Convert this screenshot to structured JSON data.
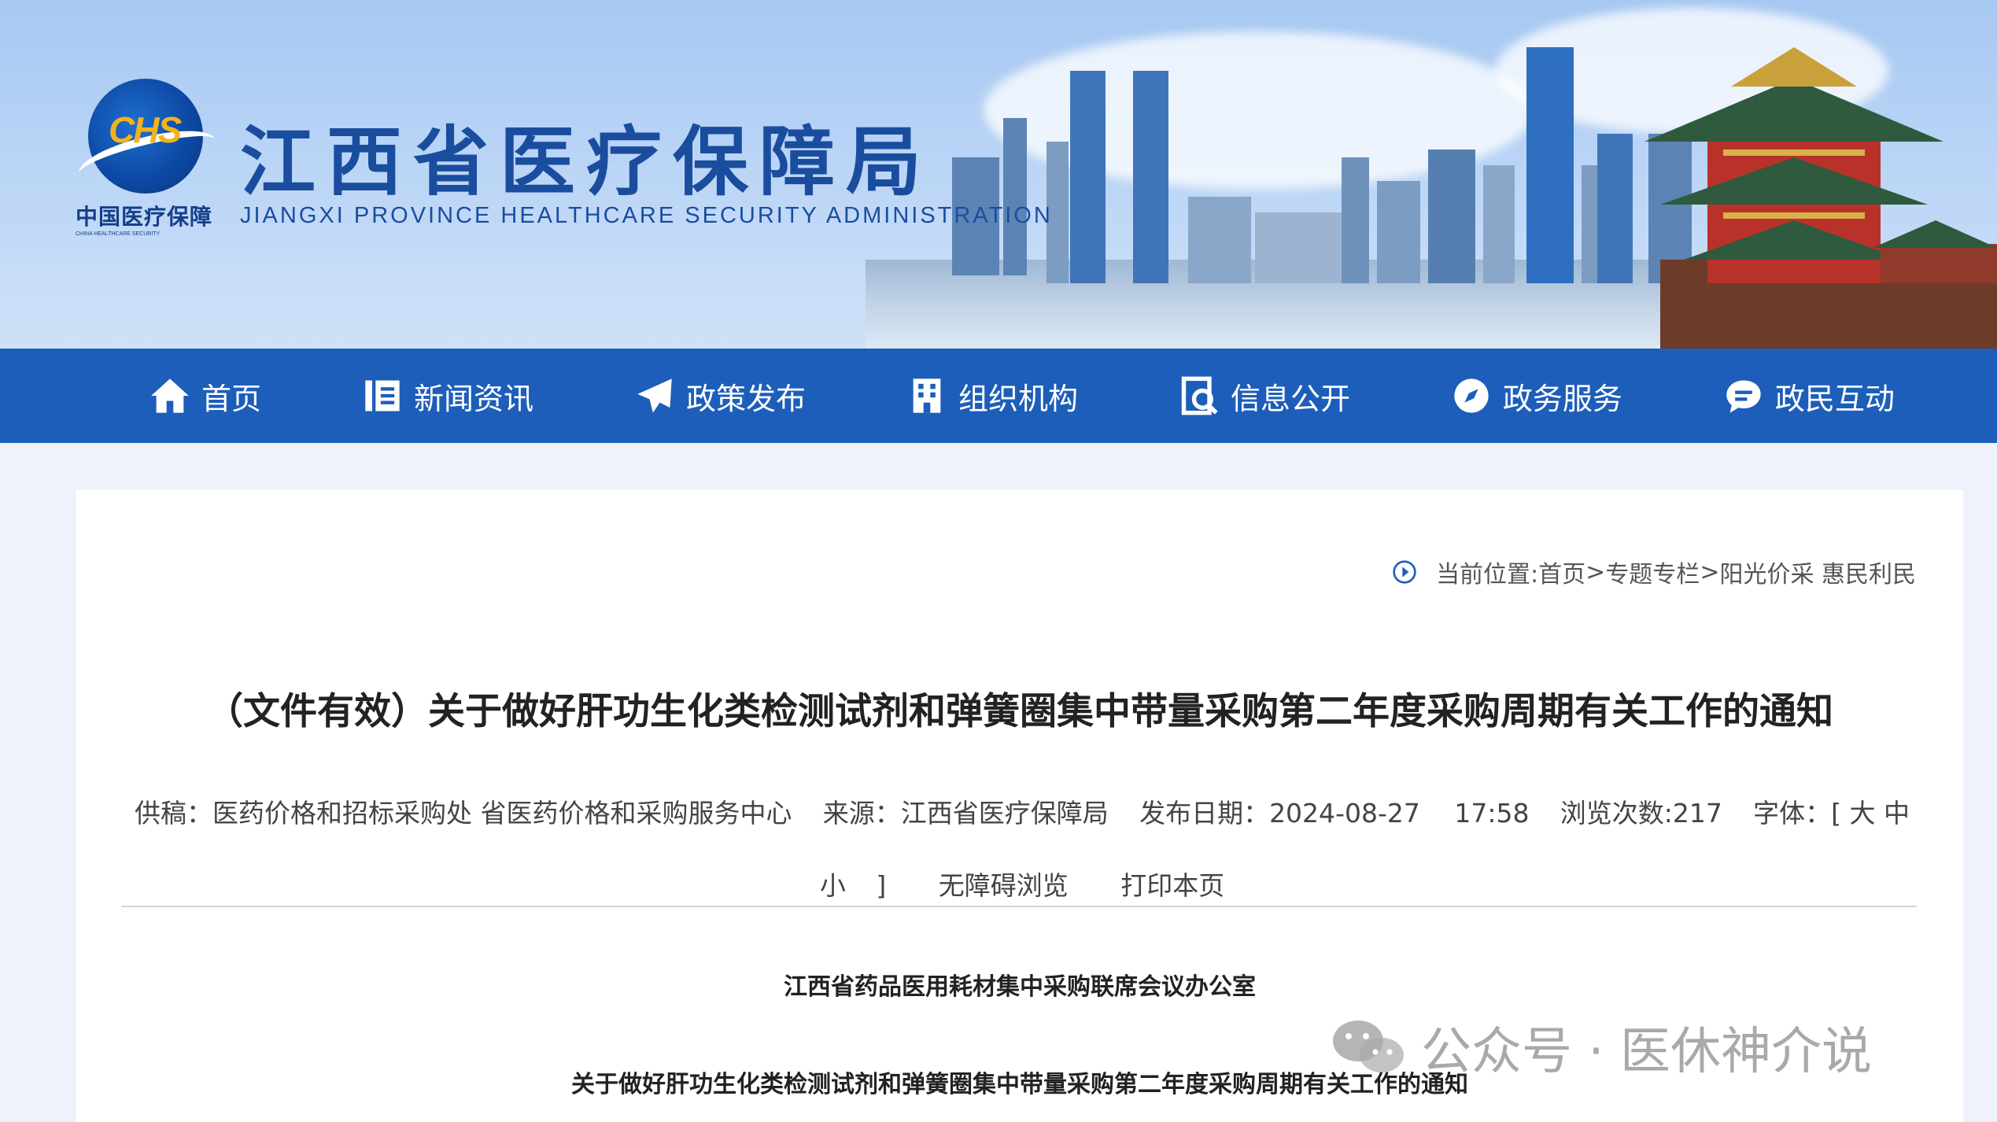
{
  "header": {
    "logo_cn": "中国医疗保障",
    "logo_en": "CHINA HEALTHCARE SECURITY",
    "logo_mark": "CHS",
    "title": "江西省医疗保障局",
    "subtitle": "JIANGXI PROVINCE HEALTHCARE SECURITY ADMINISTRATION"
  },
  "nav": [
    {
      "label": "首页",
      "icon": "home-icon"
    },
    {
      "label": "新闻资讯",
      "icon": "news-icon"
    },
    {
      "label": "政策发布",
      "icon": "paper-plane-icon"
    },
    {
      "label": "组织机构",
      "icon": "building-icon"
    },
    {
      "label": "信息公开",
      "icon": "document-search-icon"
    },
    {
      "label": "政务服务",
      "icon": "compass-icon"
    },
    {
      "label": "政民互动",
      "icon": "chat-icon"
    }
  ],
  "breadcrumb": {
    "prefix": "当前位置:",
    "items": [
      "首页",
      "专题专栏",
      "阳光价采 惠民利民"
    ],
    "separator": ">"
  },
  "article": {
    "title": "（文件有效）关于做好肝功生化类检测试剂和弹簧圈集中带量采购第二年度采购周期有关工作的通知",
    "meta": {
      "contributor": "供稿：医药价格和招标采购处 省医药价格和采购服务中心",
      "source": "来源：江西省医疗保障局",
      "date": "发布日期：2024-08-27　 17:58",
      "views": "浏览次数:217",
      "font_label": "字体：[",
      "font_large": "大",
      "font_medium": "中",
      "font_small": "小",
      "font_close": "]",
      "accessible": "无障碍浏览",
      "print": "打印本页"
    },
    "body_org": "江西省药品医用耗材集中采购联席会议办公室",
    "body_title": "关于做好肝功生化类检测试剂和弹簧圈集中带量采购第二年度采购周期有关工作的通知"
  },
  "watermark": "公众号 · 医休神介说",
  "colors": {
    "nav_bg": "#1d5eba",
    "title_blue": "#1a4d9e",
    "logo_gold": "#f3b21c"
  }
}
